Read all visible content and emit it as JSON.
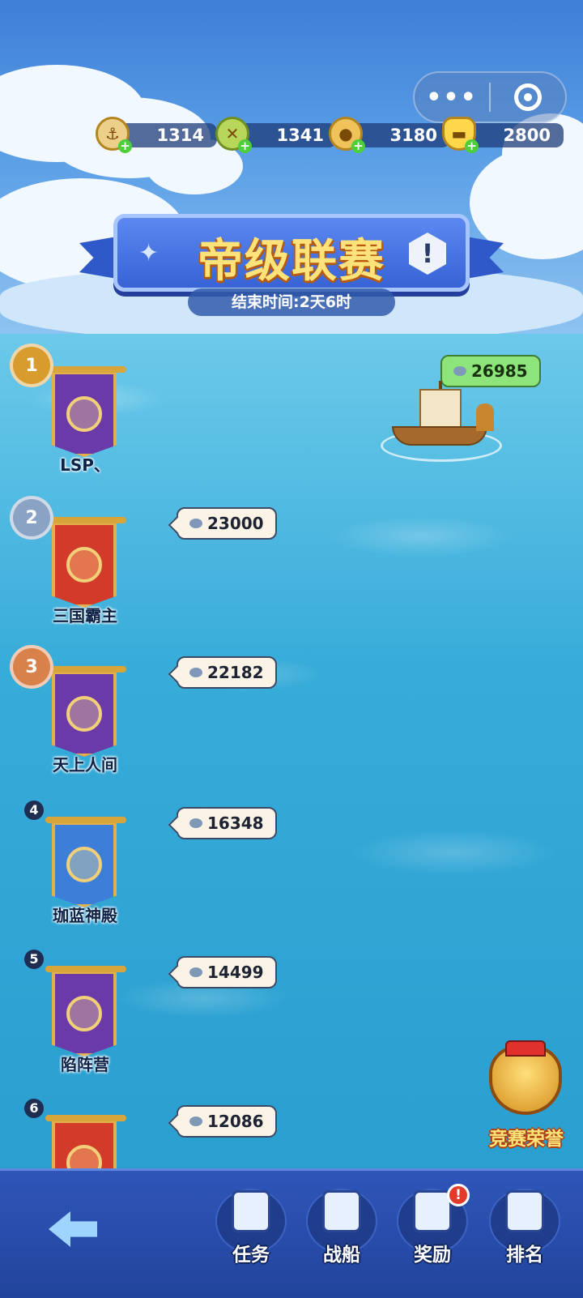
{
  "capsule": {
    "more_icon": "more-dots-icon",
    "close_icon": "target-icon"
  },
  "resources": [
    {
      "name": "anchor",
      "icon": "anchor-icon",
      "value": "1314",
      "color": "#c9a34a"
    },
    {
      "name": "compass",
      "icon": "compass-icon",
      "value": "1341",
      "color": "#8cb83a"
    },
    {
      "name": "coin",
      "icon": "coin-icon",
      "value": "3180",
      "color": "#e2a93a"
    },
    {
      "name": "ingot",
      "icon": "gold-ingot-icon",
      "value": "2800",
      "color": "#f3c02e"
    }
  ],
  "header": {
    "title": "帝级联赛",
    "end_time": "结束时间:2天6时"
  },
  "ship": {
    "score": "26985"
  },
  "rankings": [
    {
      "rank": "1",
      "team": "LSP、",
      "score": "",
      "flag_color": "#6a3aa8",
      "medal_color": "#d89b2e"
    },
    {
      "rank": "2",
      "team": "三国霸主",
      "score": "23000",
      "flag_color": "#d23b2a",
      "medal_color": "#8aa2c4"
    },
    {
      "rank": "3",
      "team": "天上人间",
      "score": "22182",
      "flag_color": "#6a3aa8",
      "medal_color": "#d9814a"
    },
    {
      "rank": "4",
      "team": "珈蓝神殿",
      "score": "16348",
      "flag_color": "#3d7fd8"
    },
    {
      "rank": "5",
      "team": "陷阵营",
      "score": "14499",
      "flag_color": "#6a3aa8"
    },
    {
      "rank": "6",
      "team": "",
      "score": "12086",
      "flag_color": "#d23b2a"
    }
  ],
  "honor": {
    "label": "竞赛荣誉"
  },
  "nav": {
    "back_icon": "back-arrow-icon",
    "items": [
      {
        "label": "任务",
        "icon": "scroll-icon"
      },
      {
        "label": "战船",
        "icon": "warship-icon"
      },
      {
        "label": "奖励",
        "icon": "treasure-chest-icon",
        "badge": "!"
      },
      {
        "label": "排名",
        "icon": "ranking-star-icon"
      }
    ]
  },
  "colors": {
    "sky": "#4f90e0",
    "sea": "#37acd9",
    "bar": "#2e55b9",
    "title_text": "#ffe27a",
    "ship_score_bg": "#8ce47a"
  }
}
